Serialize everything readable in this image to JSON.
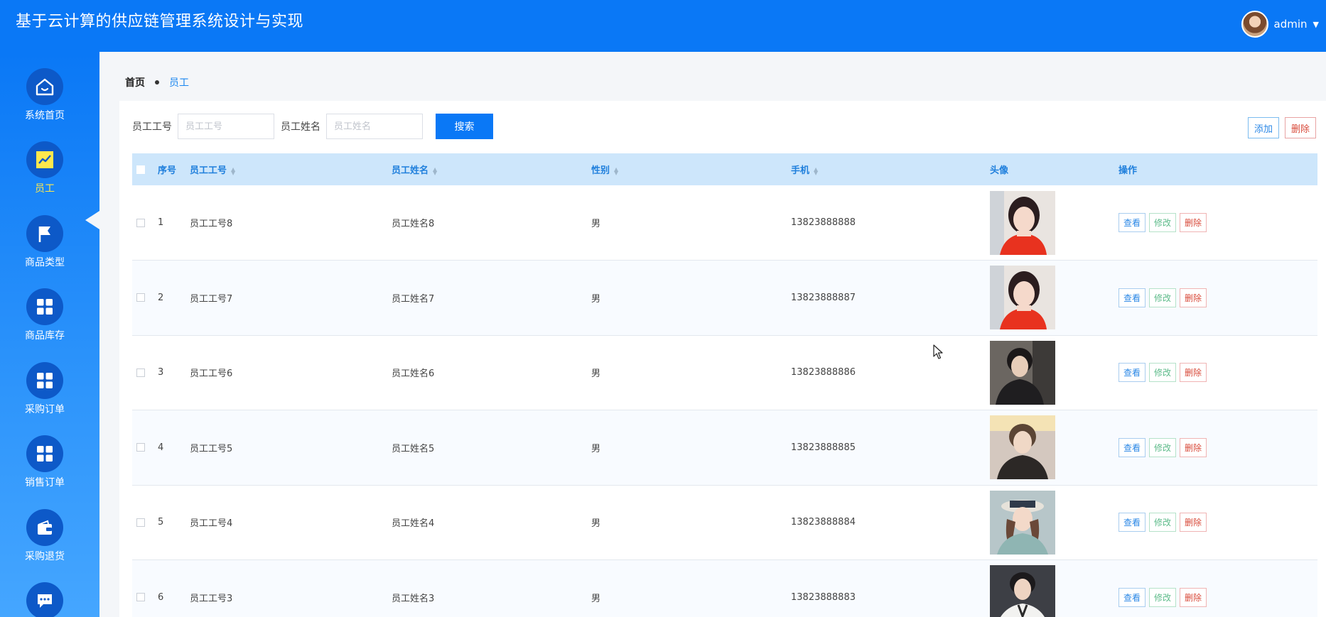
{
  "header": {
    "title": "基于云计算的供应链管理系统设计与实现",
    "username": "admin"
  },
  "sidebar": {
    "items": [
      {
        "label": "系统首页",
        "icon": "home-icon"
      },
      {
        "label": "员工",
        "icon": "chart-icon",
        "active": true
      },
      {
        "label": "商品类型",
        "icon": "flag-icon"
      },
      {
        "label": "商品库存",
        "icon": "grid-icon"
      },
      {
        "label": "采购订单",
        "icon": "grid-icon"
      },
      {
        "label": "销售订单",
        "icon": "grid-icon"
      },
      {
        "label": "采购退货",
        "icon": "wallet-icon"
      },
      {
        "label": "",
        "icon": "chat-icon"
      }
    ]
  },
  "breadcrumb": {
    "home": "首页",
    "current": "员工"
  },
  "search": {
    "id_label": "员工工号",
    "id_placeholder": "员工工号",
    "name_label": "员工姓名",
    "name_placeholder": "员工姓名",
    "button": "搜索"
  },
  "actions": {
    "add": "添加",
    "delete": "删除"
  },
  "table": {
    "headers": {
      "index": "序号",
      "emp_id": "员工工号",
      "emp_name": "员工姓名",
      "gender": "性别",
      "phone": "手机",
      "avatar": "头像",
      "ops": "操作"
    },
    "op_labels": {
      "view": "查看",
      "edit": "修改",
      "delete": "删除"
    },
    "rows": [
      {
        "index": "1",
        "emp_id": "员工工号8",
        "emp_name": "员工姓名8",
        "gender": "男",
        "phone": "13823888888",
        "photo": "girl-red"
      },
      {
        "index": "2",
        "emp_id": "员工工号7",
        "emp_name": "员工姓名7",
        "gender": "男",
        "phone": "13823888887",
        "photo": "girl-red"
      },
      {
        "index": "3",
        "emp_id": "员工工号6",
        "emp_name": "员工姓名6",
        "gender": "男",
        "phone": "13823888886",
        "photo": "boy-dark"
      },
      {
        "index": "4",
        "emp_id": "员工工号5",
        "emp_name": "员工姓名5",
        "gender": "男",
        "phone": "13823888885",
        "photo": "boy-light"
      },
      {
        "index": "5",
        "emp_id": "员工工号4",
        "emp_name": "员工姓名4",
        "gender": "男",
        "phone": "13823888884",
        "photo": "girl-hat"
      },
      {
        "index": "6",
        "emp_id": "员工工号3",
        "emp_name": "员工姓名3",
        "gender": "男",
        "phone": "13823888883",
        "photo": "boy-white"
      }
    ]
  },
  "colors": {
    "primary": "#0a78f6",
    "active_nav": "#ffe84d",
    "table_header": "#cde6fb"
  }
}
